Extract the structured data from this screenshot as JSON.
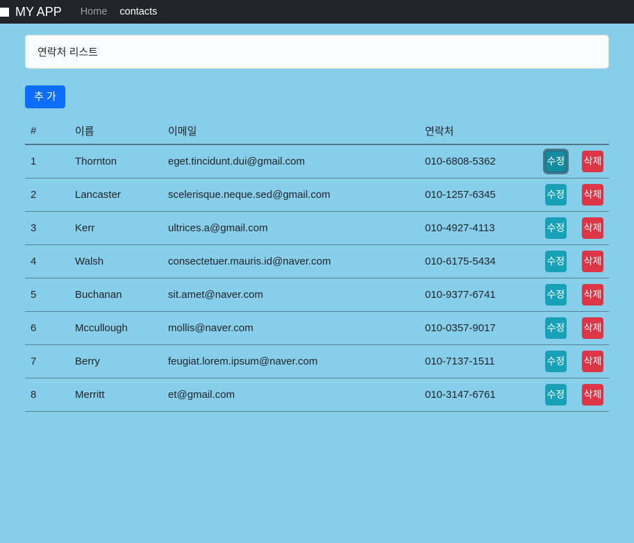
{
  "navbar": {
    "brand": "MY APP",
    "items": [
      {
        "label": "Home",
        "active": false
      },
      {
        "label": "contacts",
        "active": true
      }
    ]
  },
  "card": {
    "title": "연락처 리스트"
  },
  "toolbar": {
    "add_label": "추 가"
  },
  "table": {
    "headers": [
      "#",
      "이름",
      "이메일",
      "연락처"
    ],
    "edit_label": "수정",
    "delete_label": "삭제",
    "rows": [
      {
        "no": "1",
        "name": "Thornton",
        "email": "eget.tincidunt.dui@gmail.com",
        "phone": "010-6808-5362"
      },
      {
        "no": "2",
        "name": "Lancaster",
        "email": "scelerisque.neque.sed@gmail.com",
        "phone": "010-1257-6345"
      },
      {
        "no": "3",
        "name": "Kerr",
        "email": "ultrices.a@gmail.com",
        "phone": "010-4927-4113"
      },
      {
        "no": "4",
        "name": "Walsh",
        "email": "consectetuer.mauris.id@naver.com",
        "phone": "010-6175-5434"
      },
      {
        "no": "5",
        "name": "Buchanan",
        "email": "sit.amet@naver.com",
        "phone": "010-9377-6741"
      },
      {
        "no": "6",
        "name": "Mccullough",
        "email": "mollis@naver.com",
        "phone": "010-0357-9017"
      },
      {
        "no": "7",
        "name": "Berry",
        "email": "feugiat.lorem.ipsum@naver.com",
        "phone": "010-7137-1511"
      },
      {
        "no": "8",
        "name": "Merritt",
        "email": "et@gmail.com",
        "phone": "010-3147-6761"
      }
    ]
  },
  "colors": {
    "background": "#87ceeb",
    "navbar": "#212529",
    "primary": "#0d6efd",
    "info": "#17a2b8",
    "danger": "#dc3545"
  }
}
